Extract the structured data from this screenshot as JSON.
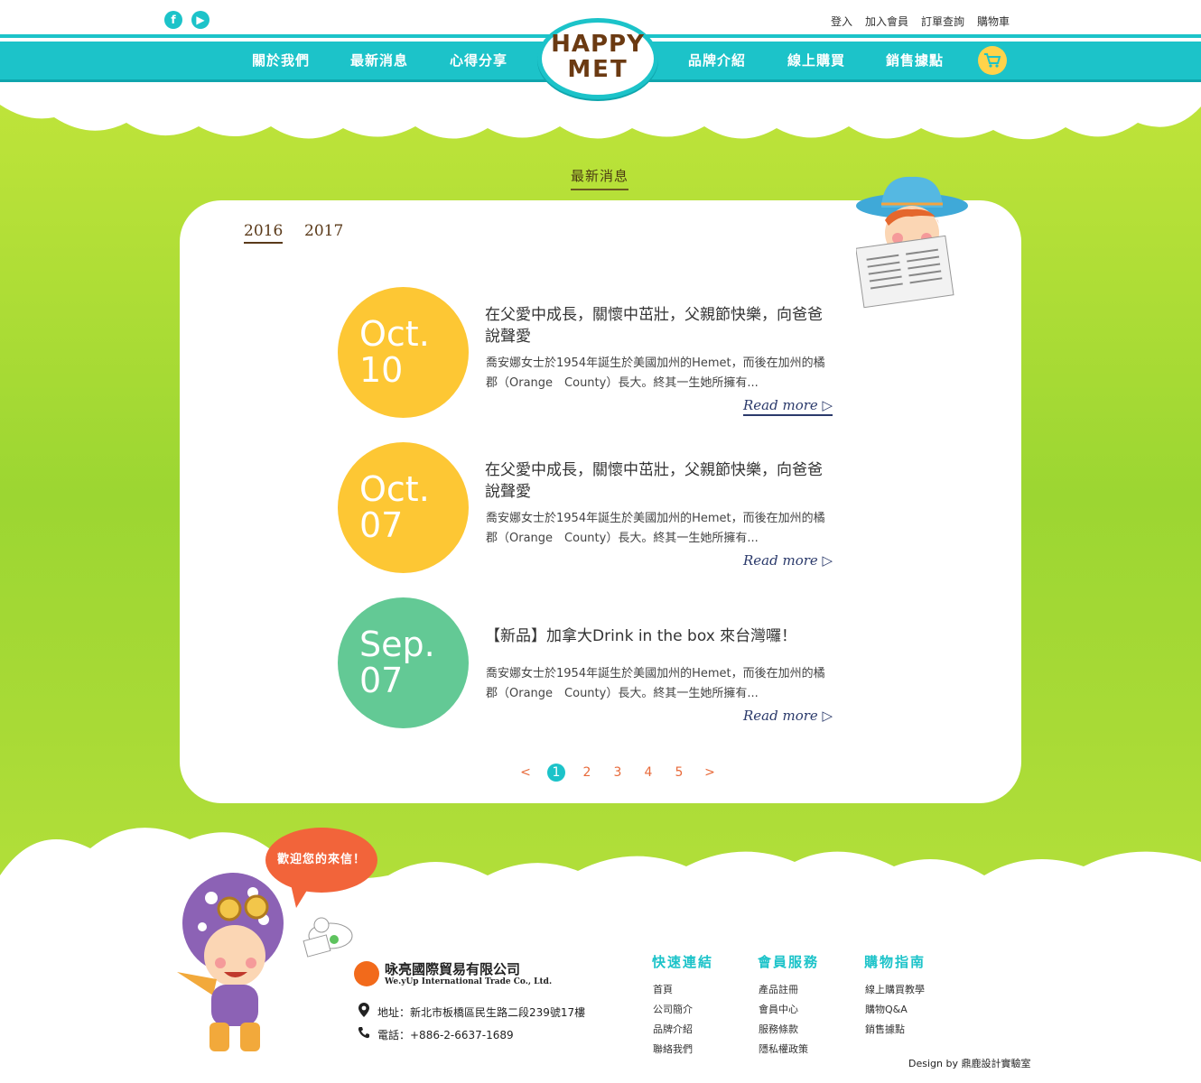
{
  "header": {
    "social": [
      {
        "icon": "facebook-icon",
        "glyph": "f"
      },
      {
        "icon": "youtube-icon",
        "glyph": "▶"
      }
    ],
    "utility_links": [
      "登入",
      "加入會員",
      "訂單查詢",
      "購物車"
    ],
    "nav_left": [
      "關於我們",
      "最新消息",
      "心得分享"
    ],
    "nav_right": [
      "品牌介紹",
      "線上購買",
      "銷售據點"
    ],
    "logo": {
      "line1": "HAPPY",
      "line2": "MET"
    },
    "cart_icon": "cart-icon",
    "accent_color": "#1cc3c9"
  },
  "section": {
    "title": "最新消息"
  },
  "years": [
    "2016",
    "2017"
  ],
  "active_year": "2016",
  "news": [
    {
      "month": "Oct.",
      "day": "10",
      "color": "#fdc734",
      "title": "在父愛中成長，關懷中茁壯，父親節快樂，向爸爸說聲愛",
      "body": "喬安娜女士於1954年誕生於美國加州的Hemet，而後在加州的橘郡（Orange　County）長大。終其一生她所擁有...",
      "more": "Read more ▷"
    },
    {
      "month": "Oct.",
      "day": "07",
      "color": "#fdc734",
      "title": "在父愛中成長，關懷中茁壯，父親節快樂，向爸爸說聲愛",
      "body": "喬安娜女士於1954年誕生於美國加州的Hemet，而後在加州的橘郡（Orange　County）長大。終其一生她所擁有...",
      "more": "Read more ▷"
    },
    {
      "month": "Sep.",
      "day": "07",
      "color": "#63c995",
      "title": "【新品】加拿大Drink in the box 來台灣囉！",
      "body": "喬安娜女士於1954年誕生於美國加州的Hemet，而後在加州的橘郡（Orange　County）長大。終其一生她所擁有...",
      "more": "Read more ▷"
    }
  ],
  "pagination": {
    "prev": "<",
    "pages": [
      "1",
      "2",
      "3",
      "4",
      "5"
    ],
    "current": "1",
    "next": ">"
  },
  "footer": {
    "bubble": "歡迎您的來信！",
    "company_cn": "咏亮國際貿易有限公司",
    "company_en": "We.yUp International Trade Co., Ltd.",
    "address": "地址：新北市板橋區民生路二段239號17樓",
    "phone": "電話：+886-2-6637-1689",
    "columns": [
      {
        "title": "快速連結",
        "links": [
          "首頁",
          "公司簡介",
          "品牌介紹",
          "聯絡我們"
        ]
      },
      {
        "title": "會員服務",
        "links": [
          "產品註冊",
          "會員中心",
          "服務條款",
          "隱私權政策"
        ]
      },
      {
        "title": "購物指南",
        "links": [
          "線上購買教學",
          "購物Q&A",
          "銷售據點"
        ]
      }
    ],
    "credit": "Design by 鼎鹿設計實驗室"
  }
}
